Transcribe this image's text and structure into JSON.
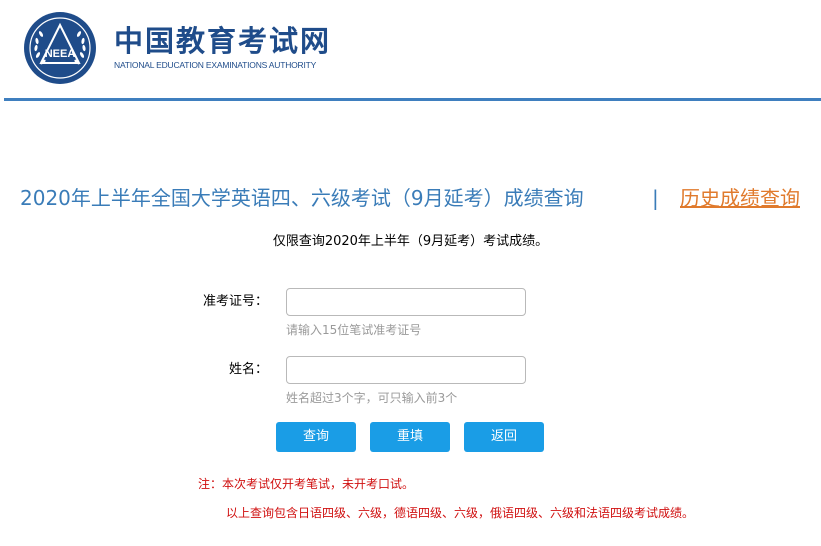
{
  "header": {
    "logo_text": "NEEA",
    "title_cn": "中国教育考试网",
    "title_en": "NATIONAL EDUCATION EXAMINATIONS AUTHORITY"
  },
  "main": {
    "title": "2020年上半年全国大学英语四、六级考试（9月延考）成绩查询",
    "separator": "|",
    "history_link": "历史成绩查询",
    "subtitle": "仅限查询2020年上半年（9月延考）考试成绩。"
  },
  "form": {
    "ticket_label": "准考证号：",
    "ticket_value": "",
    "ticket_hint": "请输入15位笔试准考证号",
    "name_label": "姓名：",
    "name_value": "",
    "name_hint": "姓名超过3个字，可只输入前3个"
  },
  "buttons": {
    "query": "查询",
    "reset": "重填",
    "back": "返回"
  },
  "notes": {
    "note1": "注：本次考试仅开考笔试，未开考口试。",
    "note2": "以上查询包含日语四级、六级，德语四级、六级，俄语四级、六级和法语四级考试成绩。"
  },
  "colors": {
    "brand_blue": "#1f4c8a",
    "title_blue": "#3a7cb8",
    "link_orange": "#e07a2c",
    "button_blue": "#1a9de6",
    "note_red": "#d01010"
  }
}
